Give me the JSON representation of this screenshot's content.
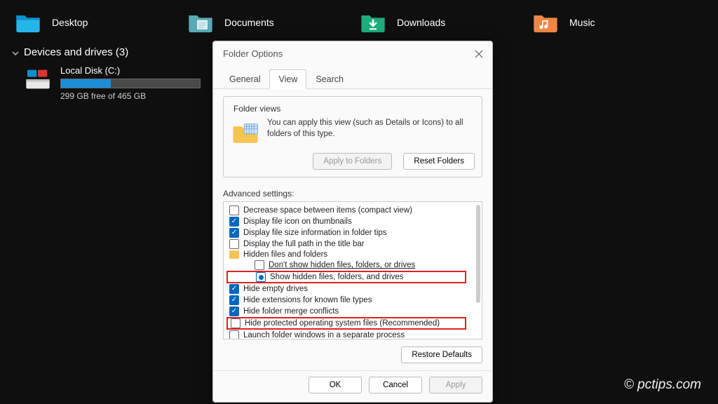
{
  "quick_access": [
    {
      "label": "Desktop"
    },
    {
      "label": "Documents"
    },
    {
      "label": "Downloads"
    },
    {
      "label": "Music"
    }
  ],
  "devices": {
    "header": "Devices and drives (3)",
    "drive": {
      "name": "Local Disk (C:)",
      "free_text": "299 GB free of 465 GB",
      "fill_pct": 36
    }
  },
  "dialog": {
    "title": "Folder Options",
    "tabs": {
      "general": "General",
      "view": "View",
      "search": "Search"
    },
    "folder_views": {
      "legend": "Folder views",
      "desc": "You can apply this view (such as Details or Icons) to all folders of this type.",
      "apply": "Apply to Folders",
      "reset": "Reset Folders"
    },
    "advanced": {
      "label": "Advanced settings:",
      "options": [
        {
          "type": "cb",
          "checked": false,
          "text": "Decrease space between items (compact view)"
        },
        {
          "type": "cb",
          "checked": true,
          "text": "Display file icon on thumbnails"
        },
        {
          "type": "cb",
          "checked": true,
          "text": "Display file size information in folder tips"
        },
        {
          "type": "cb",
          "checked": false,
          "text": "Display the full path in the title bar"
        },
        {
          "type": "folder",
          "text": "Hidden files and folders"
        },
        {
          "type": "rb",
          "checked": false,
          "indent": 2,
          "text": "Don't show hidden files, folders, or drives",
          "underline": true
        },
        {
          "type": "rb",
          "checked": true,
          "indent": 2,
          "text": "Show hidden files, folders, and drives",
          "hl": true
        },
        {
          "type": "cb",
          "checked": true,
          "text": "Hide empty drives"
        },
        {
          "type": "cb",
          "checked": true,
          "text": "Hide extensions for known file types"
        },
        {
          "type": "cb",
          "checked": true,
          "text": "Hide folder merge conflicts"
        },
        {
          "type": "cb",
          "checked": false,
          "text": "Hide protected operating system files (Recommended)",
          "hl": true
        },
        {
          "type": "cb",
          "checked": false,
          "text": "Launch folder windows in a separate process"
        }
      ],
      "restore": "Restore Defaults"
    },
    "footer": {
      "ok": "OK",
      "cancel": "Cancel",
      "apply": "Apply"
    }
  },
  "watermark": "© pctips.com"
}
